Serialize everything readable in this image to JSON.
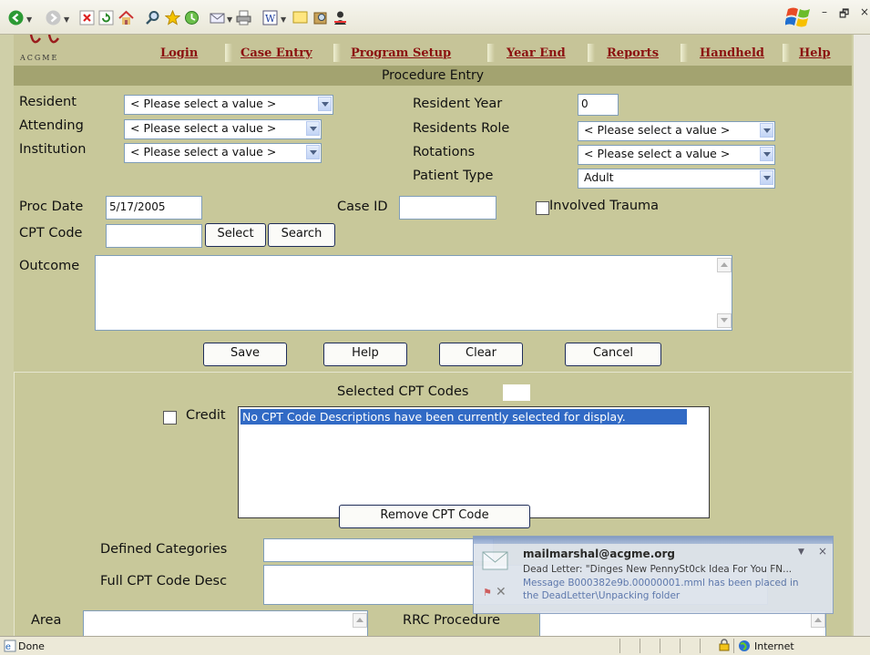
{
  "browser": {
    "status_text": "Done",
    "zone_text": "Internet",
    "window_controls": {
      "minimize": "–",
      "restore": "🗗",
      "close": "×"
    }
  },
  "nav": {
    "logo_text": "ACGME",
    "links": [
      "Login",
      "Case Entry",
      "Program Setup",
      "Year End",
      "Reports",
      "Handheld",
      "Help"
    ]
  },
  "page": {
    "title": "Procedure Entry"
  },
  "form": {
    "resident_label": "Resident",
    "resident_value": "< Please select a value >",
    "attending_label": "Attending",
    "attending_value": "< Please select a value >",
    "institution_label": "Institution",
    "institution_value": "< Please select a value >",
    "resident_year_label": "Resident Year",
    "resident_year_value": "0",
    "residents_role_label": "Residents Role",
    "residents_role_value": "< Please select a value >",
    "rotations_label": "Rotations",
    "rotations_value": "< Please select a value >",
    "patient_type_label": "Patient Type",
    "patient_type_value": "Adult",
    "proc_date_label": "Proc Date",
    "proc_date_value": "5/17/2005",
    "case_id_label": "Case ID",
    "case_id_value": "",
    "involved_trauma_label": "Involved Trauma",
    "cpt_code_label": "CPT Code",
    "cpt_code_value": "",
    "select_button": "Select",
    "search_button": "Search",
    "outcome_label": "Outcome",
    "save_button": "Save",
    "help_button": "Help",
    "clear_button": "Clear",
    "cancel_button": "Cancel"
  },
  "cpt": {
    "selected_label": "Selected CPT Codes",
    "selected_count": "",
    "credit_label": "Credit",
    "list_items": [
      "No CPT Code Descriptions have been currently selected for display."
    ],
    "remove_button": "Remove CPT Code",
    "defined_categories_label": "Defined Categories",
    "full_desc_label": "Full CPT Code Desc",
    "area_label": "Area",
    "rrc_label": "RRC Procedure"
  },
  "toast": {
    "sender": "mailmarshal@acgme.org",
    "subject": "Dead Letter: \"Dinges New PennySt0ck Idea For You FN...",
    "line1": "Message B000382e9b.00000001.mml has been placed in",
    "line2": "the DeadLetter\\Unpacking folder"
  }
}
